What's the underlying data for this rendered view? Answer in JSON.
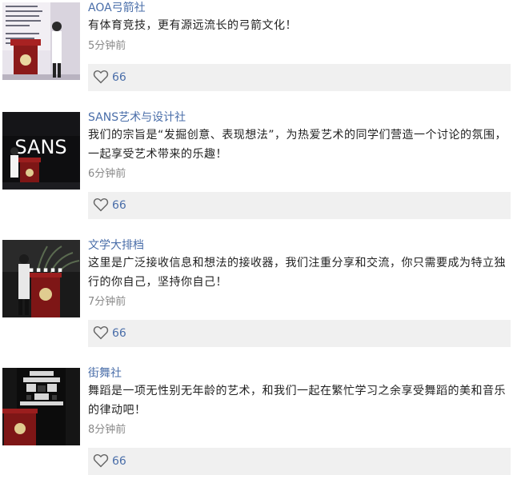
{
  "posts": [
    {
      "title": "AOA弓箭社",
      "body": "有体育竞技，更有源远流长的弓箭文化！",
      "time": "5分钟前",
      "likes": "66",
      "thumb_label": ""
    },
    {
      "title": "SANS艺术与设计社",
      "body": "我们的宗旨是“发掘创意、表现想法”，为热爱艺术的同学们营造一个讨论的氛围，一起享受艺术带来的乐趣！",
      "time": "6分钟前",
      "likes": "66",
      "thumb_label": "SANS"
    },
    {
      "title": "文学大排档",
      "body": "这里是广泛接收信息和想法的接收器，我们注重分享和交流，你只需要成为特立独行的你自己，坚持你自己！",
      "time": "7分钟前",
      "likes": "66",
      "thumb_label": ""
    },
    {
      "title": "街舞社",
      "body": "舞蹈是一项无性别无年龄的艺术，和我们一起在繁忙学习之余享受舞蹈的美和音乐的律动吧！",
      "time": "8分钟前",
      "likes": "66",
      "thumb_label": ""
    }
  ],
  "colors": {
    "accent": "#4a6ea9",
    "text": "#222222",
    "meta": "#888888",
    "like_bar": "#f0f0f0"
  },
  "icons": {
    "like": "heart-outline-icon"
  }
}
